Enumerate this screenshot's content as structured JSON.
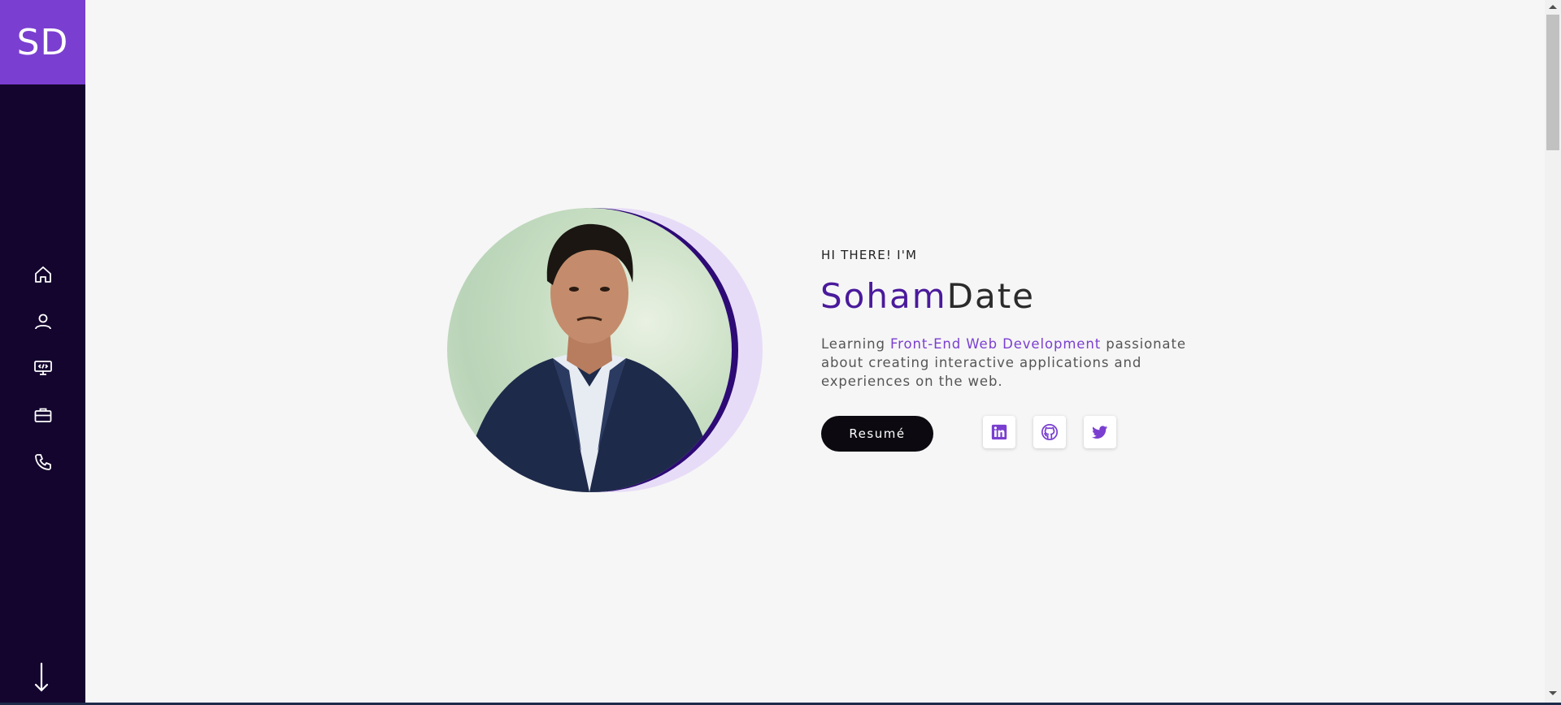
{
  "logo": {
    "text": "SD"
  },
  "nav": {
    "items": [
      {
        "name": "home",
        "icon": "home-icon"
      },
      {
        "name": "about",
        "icon": "user-icon"
      },
      {
        "name": "skills",
        "icon": "monitor-code-icon"
      },
      {
        "name": "work",
        "icon": "briefcase-icon"
      },
      {
        "name": "contact",
        "icon": "phone-icon"
      }
    ],
    "scroll_icon": "arrow-down-icon"
  },
  "hero": {
    "eyebrow": "HI THERE! I'M",
    "first_name": "Soham",
    "last_name": "Date",
    "desc_prefix": "Learning ",
    "desc_accent": "Front-End Web Development",
    "desc_suffix": " passionate about creating interactive applications and experiences on the web.",
    "resume_label": "Resumé",
    "social": [
      {
        "name": "linkedin",
        "icon": "linkedin-icon"
      },
      {
        "name": "github",
        "icon": "github-icon"
      },
      {
        "name": "twitter",
        "icon": "twitter-icon"
      }
    ]
  },
  "colors": {
    "sidebar_bg": "#14052e",
    "logo_bg": "#7a3fd0",
    "accent": "#7a3fd0",
    "name_first": "#4a1a9c",
    "ring": "#2d0a75",
    "halo": "#e7dcf7",
    "button_bg": "#0c0a10"
  }
}
